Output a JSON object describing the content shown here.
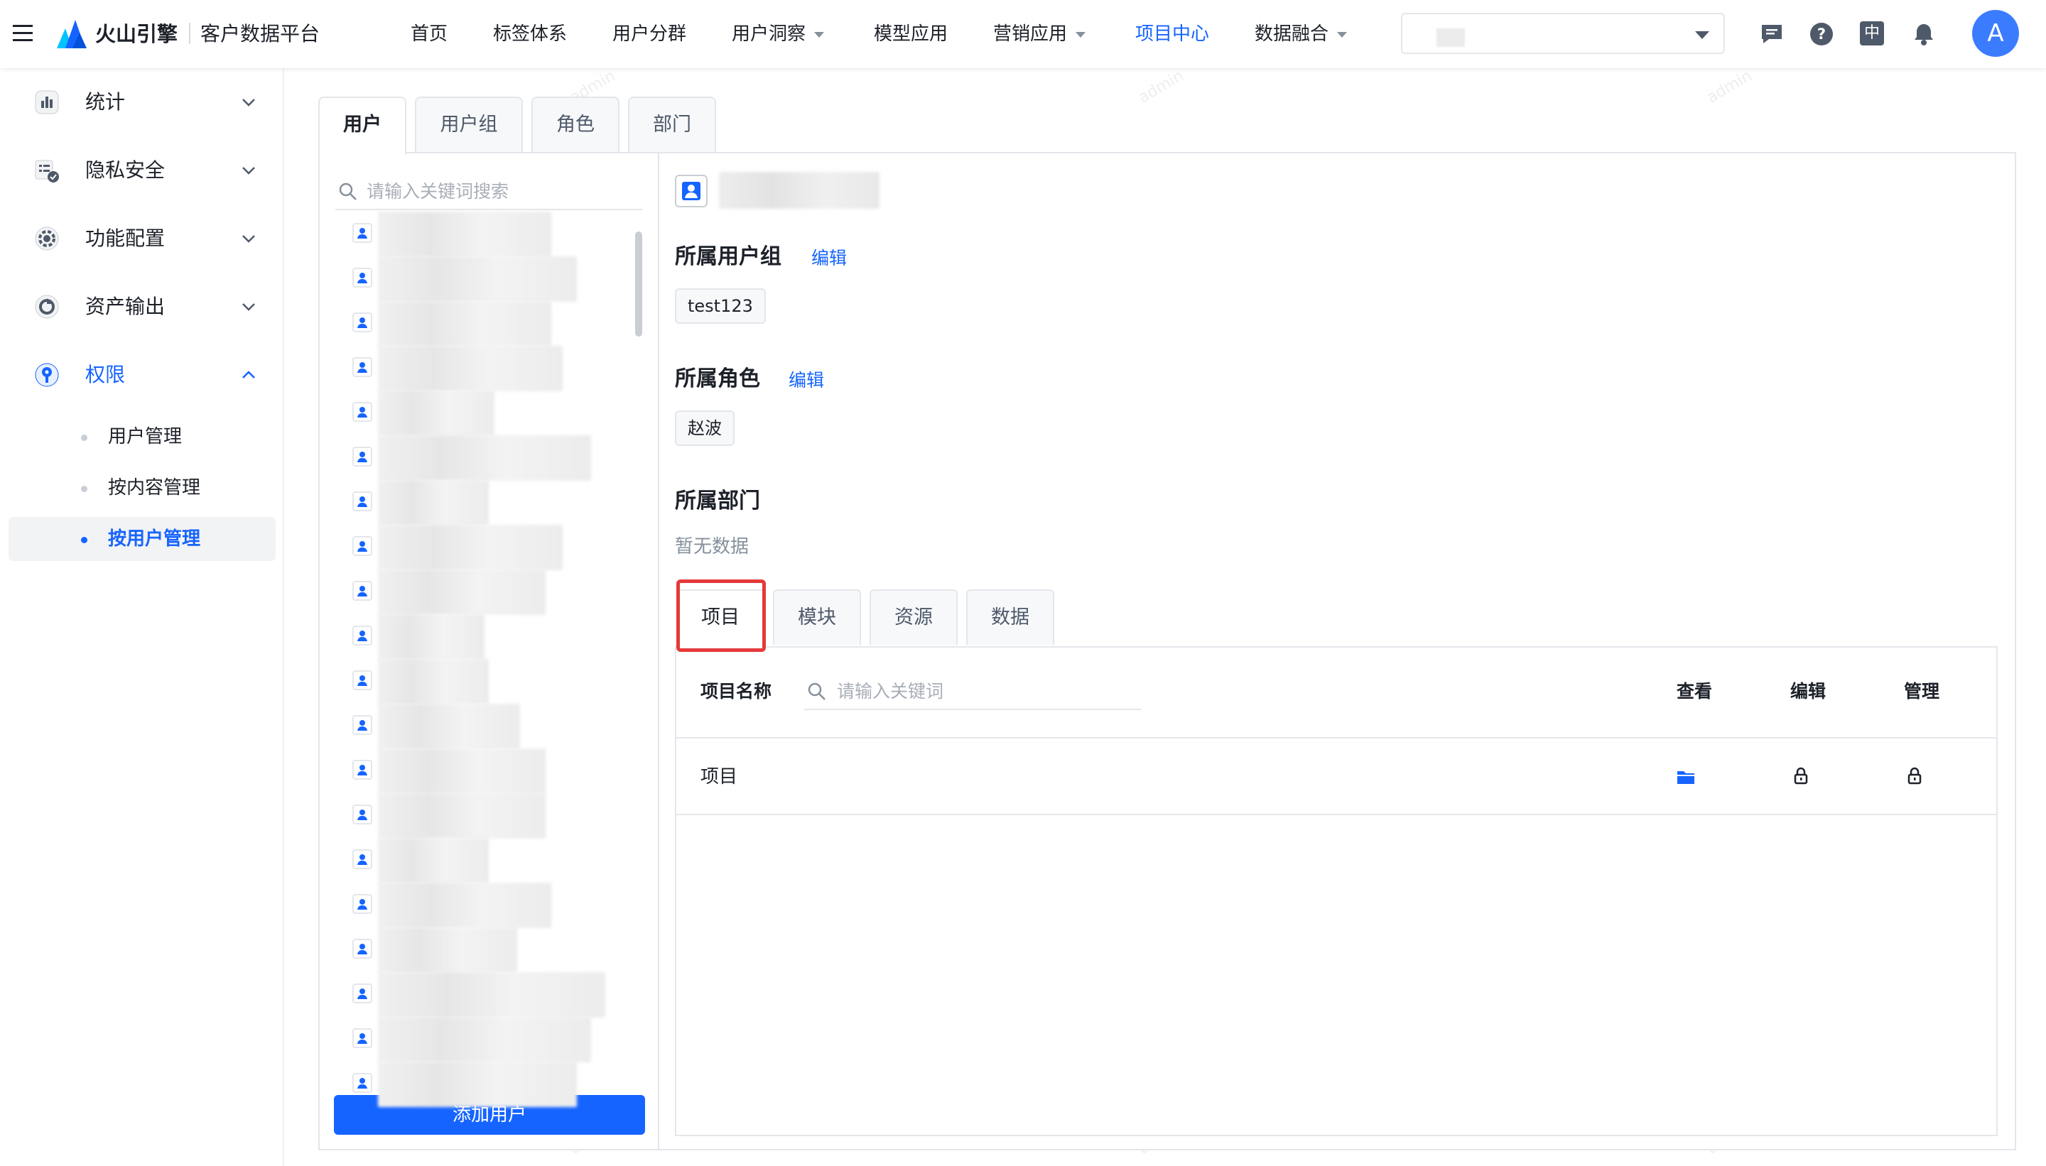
{
  "app": {
    "brand": "火山引擎",
    "product": "客户数据平台"
  },
  "topnav": {
    "items": [
      {
        "label": "首页",
        "dropdown": false,
        "active": false
      },
      {
        "label": "标签体系",
        "dropdown": false,
        "active": false
      },
      {
        "label": "用户分群",
        "dropdown": false,
        "active": false
      },
      {
        "label": "用户洞察",
        "dropdown": true,
        "active": false
      },
      {
        "label": "模型应用",
        "dropdown": false,
        "active": false
      },
      {
        "label": "营销应用",
        "dropdown": true,
        "active": false
      },
      {
        "label": "项目中心",
        "dropdown": false,
        "active": true
      },
      {
        "label": "数据融合",
        "dropdown": true,
        "active": false
      }
    ],
    "lang_label": "中",
    "avatar_letter": "A",
    "icons": [
      "message-icon",
      "help-icon",
      "language-icon",
      "bell-icon"
    ]
  },
  "sidebar": {
    "items": [
      {
        "label": "统计",
        "icon": "bar-chart-icon",
        "expanded": false
      },
      {
        "label": "隐私安全",
        "icon": "shield-list-icon",
        "expanded": false
      },
      {
        "label": "功能配置",
        "icon": "gear-icon",
        "expanded": false
      },
      {
        "label": "资产输出",
        "icon": "export-icon",
        "expanded": false
      },
      {
        "label": "权限",
        "icon": "key-icon",
        "expanded": true,
        "active": true
      }
    ],
    "subitems": [
      {
        "label": "用户管理",
        "active": false
      },
      {
        "label": "按内容管理",
        "active": false
      },
      {
        "label": "按用户管理",
        "active": true
      }
    ]
  },
  "main": {
    "tabs": [
      "用户",
      "用户组",
      "角色",
      "部门"
    ],
    "active_tab": "用户",
    "search_placeholder": "请输入关键词搜索",
    "add_button": "添加用户",
    "detail": {
      "group_title": "所属用户组",
      "group_edit": "编辑",
      "group_tag": "test123",
      "role_title": "所属角色",
      "role_edit": "编辑",
      "role_tag": "赵波",
      "dept_title": "所属部门",
      "dept_empty": "暂无数据"
    },
    "subtabs": [
      "项目",
      "模块",
      "资源",
      "数据"
    ],
    "active_subtab": "项目",
    "table": {
      "col_name": "项目名称",
      "search_placeholder": "请输入关键词",
      "col_view": "查看",
      "col_edit": "编辑",
      "col_manage": "管理",
      "rows": [
        {
          "name": "项目",
          "view": "folder-icon",
          "edit": "lock-icon",
          "manage": "lock-icon"
        }
      ]
    }
  },
  "watermark_text": "admin",
  "colors": {
    "accent": "#1664ff",
    "highlight": "#e5393a"
  }
}
